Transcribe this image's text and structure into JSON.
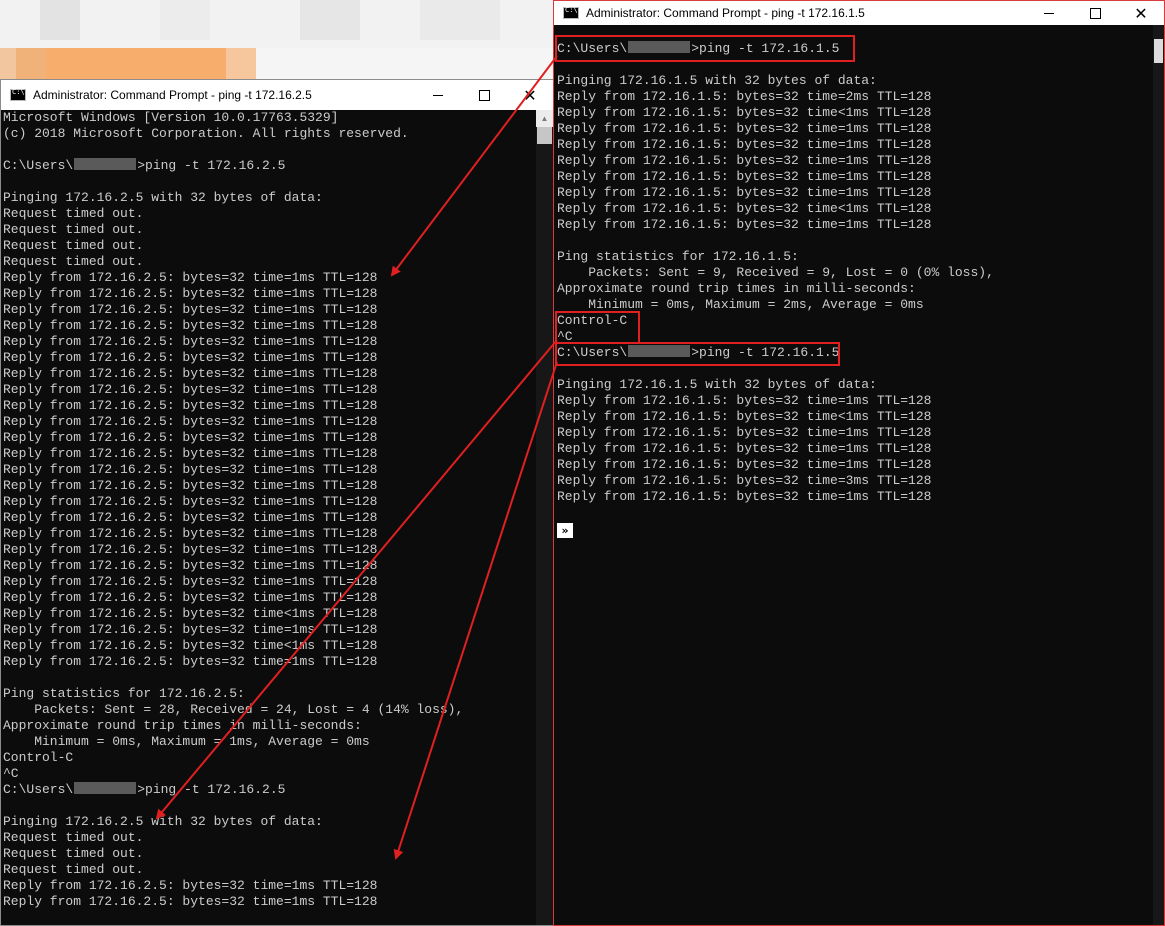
{
  "windows": {
    "left": {
      "title": "Administrator: Command Prompt - ping  -t 172.16.2.5",
      "lines": [
        "Microsoft Windows [Version 10.0.17763.5329]",
        "(c) 2018 Microsoft Corporation. All rights reserved.",
        "",
        "C:\\Users\\{mask}>ping -t 172.16.2.5",
        "",
        "Pinging 172.16.2.5 with 32 bytes of data:",
        "Request timed out.",
        "Request timed out.",
        "Request timed out.",
        "Request timed out.",
        "Reply from 172.16.2.5: bytes=32 time=1ms TTL=128",
        "Reply from 172.16.2.5: bytes=32 time=1ms TTL=128",
        "Reply from 172.16.2.5: bytes=32 time=1ms TTL=128",
        "Reply from 172.16.2.5: bytes=32 time=1ms TTL=128",
        "Reply from 172.16.2.5: bytes=32 time=1ms TTL=128",
        "Reply from 172.16.2.5: bytes=32 time=1ms TTL=128",
        "Reply from 172.16.2.5: bytes=32 time=1ms TTL=128",
        "Reply from 172.16.2.5: bytes=32 time=1ms TTL=128",
        "Reply from 172.16.2.5: bytes=32 time=1ms TTL=128",
        "Reply from 172.16.2.5: bytes=32 time=1ms TTL=128",
        "Reply from 172.16.2.5: bytes=32 time=1ms TTL=128",
        "Reply from 172.16.2.5: bytes=32 time=1ms TTL=128",
        "Reply from 172.16.2.5: bytes=32 time=1ms TTL=128",
        "Reply from 172.16.2.5: bytes=32 time=1ms TTL=128",
        "Reply from 172.16.2.5: bytes=32 time=1ms TTL=128",
        "Reply from 172.16.2.5: bytes=32 time=1ms TTL=128",
        "Reply from 172.16.2.5: bytes=32 time=1ms TTL=128",
        "Reply from 172.16.2.5: bytes=32 time=1ms TTL=128",
        "Reply from 172.16.2.5: bytes=32 time=1ms TTL=128",
        "Reply from 172.16.2.5: bytes=32 time=1ms TTL=128",
        "Reply from 172.16.2.5: bytes=32 time=1ms TTL=128",
        "Reply from 172.16.2.5: bytes=32 time<1ms TTL=128",
        "Reply from 172.16.2.5: bytes=32 time=1ms TTL=128",
        "Reply from 172.16.2.5: bytes=32 time<1ms TTL=128",
        "Reply from 172.16.2.5: bytes=32 time=1ms TTL=128",
        "",
        "Ping statistics for 172.16.2.5:",
        "    Packets: Sent = 28, Received = 24, Lost = 4 (14% loss),",
        "Approximate round trip times in milli-seconds:",
        "    Minimum = 0ms, Maximum = 1ms, Average = 0ms",
        "Control-C",
        "^C",
        "C:\\Users\\{mask}>ping -t 172.16.2.5",
        "",
        "Pinging 172.16.2.5 with 32 bytes of data:",
        "Request timed out.",
        "Request timed out.",
        "Request timed out.",
        "Reply from 172.16.2.5: bytes=32 time=1ms TTL=128",
        "Reply from 172.16.2.5: bytes=32 time=1ms TTL=128"
      ]
    },
    "right": {
      "title": "Administrator: Command Prompt - ping  -t 172.16.1.5",
      "lines": [
        "",
        "C:\\Users\\{mask}>ping -t 172.16.1.5",
        "",
        "Pinging 172.16.1.5 with 32 bytes of data:",
        "Reply from 172.16.1.5: bytes=32 time=2ms TTL=128",
        "Reply from 172.16.1.5: bytes=32 time<1ms TTL=128",
        "Reply from 172.16.1.5: bytes=32 time=1ms TTL=128",
        "Reply from 172.16.1.5: bytes=32 time=1ms TTL=128",
        "Reply from 172.16.1.5: bytes=32 time=1ms TTL=128",
        "Reply from 172.16.1.5: bytes=32 time=1ms TTL=128",
        "Reply from 172.16.1.5: bytes=32 time=1ms TTL=128",
        "Reply from 172.16.1.5: bytes=32 time<1ms TTL=128",
        "Reply from 172.16.1.5: bytes=32 time=1ms TTL=128",
        "",
        "Ping statistics for 172.16.1.5:",
        "    Packets: Sent = 9, Received = 9, Lost = 0 (0% loss),",
        "Approximate round trip times in milli-seconds:",
        "    Minimum = 0ms, Maximum = 2ms, Average = 0ms",
        "Control-C",
        "^C",
        "C:\\Users\\{mask}>ping -t 172.16.1.5",
        "",
        "Pinging 172.16.1.5 with 32 bytes of data:",
        "Reply from 172.16.1.5: bytes=32 time=1ms TTL=128",
        "Reply from 172.16.1.5: bytes=32 time<1ms TTL=128",
        "Reply from 172.16.1.5: bytes=32 time=1ms TTL=128",
        "Reply from 172.16.1.5: bytes=32 time=1ms TTL=128",
        "Reply from 172.16.1.5: bytes=32 time=1ms TTL=128",
        "Reply from 172.16.1.5: bytes=32 time=3ms TTL=128",
        "Reply from 172.16.1.5: bytes=32 time=1ms TTL=128"
      ]
    }
  },
  "colors": {
    "console_bg": "#0c0c0c",
    "console_text": "#cccccc",
    "annotation_red": "#e02020"
  },
  "icons": {
    "window_icon": "cmd-icon",
    "minimize": "minimize-icon",
    "maximize": "maximize-icon",
    "close": "close-icon"
  }
}
